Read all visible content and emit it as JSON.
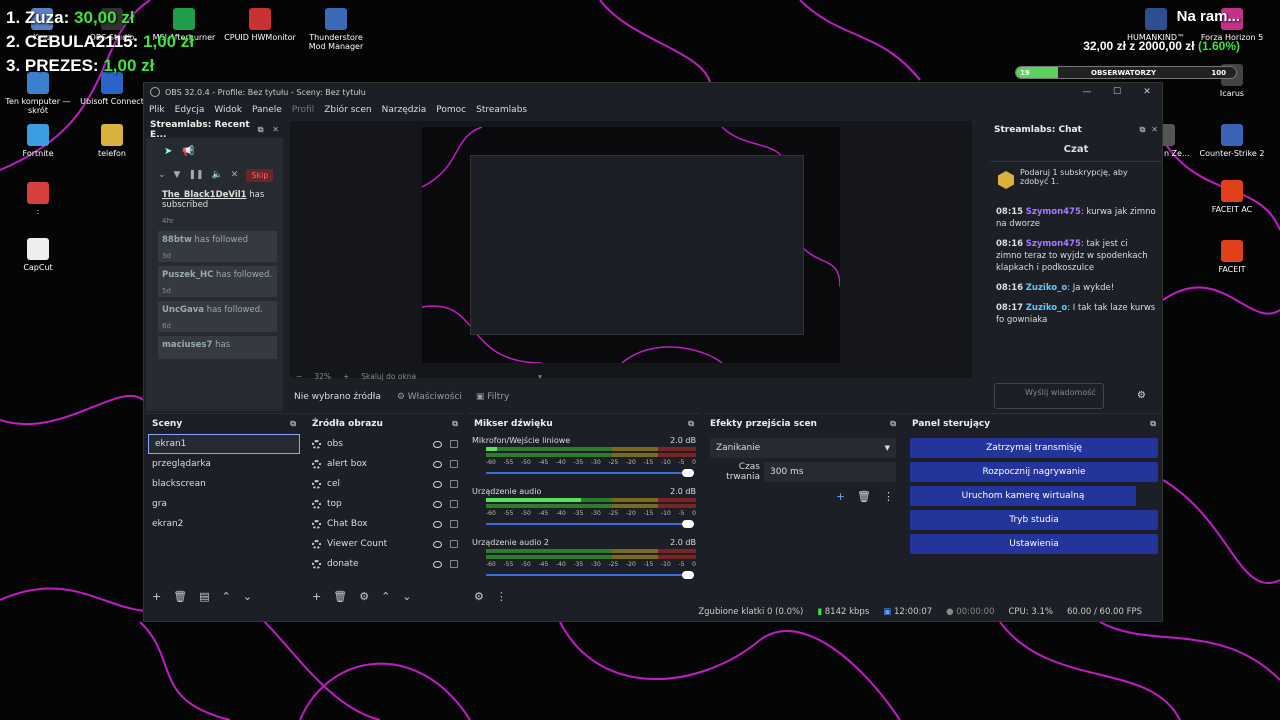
{
  "desktop": {
    "icons": [
      {
        "label": "Kosz",
        "color": "#5a7fbf"
      },
      {
        "label": "OBS Studio",
        "color": "#333"
      },
      {
        "label": "MSI Afterburner",
        "color": "#1e9e4a"
      },
      {
        "label": "CPUID HWMonitor",
        "color": "#c83232"
      },
      {
        "label": "Thunderstore Mod Manager",
        "color": "#3b6ab8"
      },
      {
        "label": "Ten komputer — skrót",
        "color": "#3a7fd0"
      },
      {
        "label": "Ubisoft Connect",
        "color": "#2b63c9"
      },
      {
        "label": "Fortnite",
        "color": "#3a9ee0"
      },
      {
        "label": "telefon",
        "color": "#d8b23a"
      },
      {
        "label": ":",
        "color": "#d84040"
      },
      {
        "label": "CapCut",
        "color": "#eee"
      },
      {
        "label": "HUMANKIND™",
        "color": "#2d4f8f"
      },
      {
        "label": "Forza Horizon 5",
        "color": "#c2328a"
      },
      {
        "label": "Icarus",
        "color": "#444"
      },
      {
        "label": "Strike n Ze...",
        "color": "#555"
      },
      {
        "label": "Counter-Strike 2",
        "color": "#3a63b8"
      },
      {
        "label": "FACEIT AC",
        "color": "#e0401a"
      },
      {
        "label": "FACEIT",
        "color": "#e0401a"
      }
    ]
  },
  "overlay": {
    "donors": [
      {
        "rank": "1. Zuza:",
        "amount": "30,00 zł"
      },
      {
        "rank": "2. CEBULA2115:",
        "amount": "1,00 zł"
      },
      {
        "rank": "3. PREZES:",
        "amount": "1,00 zł"
      }
    ],
    "goal_title": "Na ram...",
    "goal_text": "32,00 zł z 2000,00 zł",
    "goal_pct": "(1.60%)",
    "followers_label": "OBSERWATORZY",
    "followers_current": "19",
    "followers_target": "100",
    "followers_fraction": 0.19
  },
  "obs": {
    "title": "OBS 32.0.4 - Profile: Bez tytułu - Sceny: Bez tytułu",
    "menu": [
      "Plik",
      "Edycja",
      "Widok",
      "Panele",
      "Profil",
      "Zbiór scen",
      "Narzędzia",
      "Pomoc",
      "Streamlabs"
    ],
    "recent": {
      "title": "Streamlabs: Recent E...",
      "skip": "Skip",
      "events": [
        {
          "name": "The_Black1DeVil1",
          "action": "has subscribed",
          "time": "4hr"
        },
        {
          "name": "88btw",
          "action": "has followed",
          "time": "3d"
        },
        {
          "name": "Puszek_HC",
          "action": "has followed.",
          "time": "5d"
        },
        {
          "name": "UncGava",
          "action": "has followed.",
          "time": "6d"
        },
        {
          "name": "maciuses7",
          "action": "has",
          "time": ""
        }
      ]
    },
    "zoom": "32%",
    "fit": "Skaluj do okna",
    "no_source": "Nie wybrano źródła",
    "properties": "Właściwości",
    "filters": "Filtry",
    "chat": {
      "title": "Streamlabs: Chat",
      "heading": "Czat",
      "promo": "Podaruj 1 subskrypcję, aby zdobyć 1.",
      "messages": [
        {
          "time": "08:15",
          "user": "Szymon475",
          "text": ": kurwa jak zimno na dworze",
          "cls": "u1"
        },
        {
          "time": "08:16",
          "user": "Szymon475",
          "text": ": tak jest ci zimno teraz to wyjdz w spodenkach klapkach i podkoszulce",
          "cls": "u1"
        },
        {
          "time": "08:16",
          "user": "Zuziko_o",
          "text": ": Ja wykde!",
          "cls": "u2"
        },
        {
          "time": "08:17",
          "user": "Zuziko_o",
          "text": ": I tak tak laze kurws fo gowniaka",
          "cls": "u2"
        }
      ],
      "input_placeholder": "Wyślij wiadomość"
    },
    "scenes": {
      "title": "Sceny",
      "items": [
        "ekran1",
        "przeglądarka",
        "blackscrean",
        "gra",
        "ekran2"
      ]
    },
    "sources": {
      "title": "Źródła obrazu",
      "items": [
        "obs",
        "alert box",
        "cel",
        "top",
        "Chat Box",
        "Viewer Count",
        "donate"
      ]
    },
    "mixer": {
      "title": "Mikser dźwięku",
      "scale": [
        "-60",
        "-55",
        "-50",
        "-45",
        "-40",
        "-35",
        "-30",
        "-25",
        "-20",
        "-15",
        "-10",
        "-5",
        "0"
      ],
      "channels": [
        {
          "name": "Mikrofon/Wejście liniowe",
          "db": "2.0 dB",
          "level": 0.05
        },
        {
          "name": "Urządzenie audio",
          "db": "2.0 dB",
          "level": 0.45
        },
        {
          "name": "Urządzenie audio 2",
          "db": "2.0 dB",
          "level": 0.0
        }
      ]
    },
    "transitions": {
      "title": "Efekty przejścia scen",
      "selected": "Zanikanie",
      "duration_label": "Czas trwania",
      "duration": "300 ms"
    },
    "controls": {
      "title": "Panel sterujący",
      "buttons": [
        "Zatrzymaj transmisję",
        "Rozpocznij nagrywanie",
        "Uruchom kamerę wirtualną",
        "Tryb studia",
        "Ustawienia"
      ]
    },
    "status": {
      "dropped": "Zgubione klatki 0 (0.0%)",
      "kbps": "8142 kbps",
      "live_time": "12:00:07",
      "rec_time": "00:00:00",
      "cpu": "CPU: 3.1%",
      "fps": "60.00 / 60.00 FPS"
    }
  }
}
